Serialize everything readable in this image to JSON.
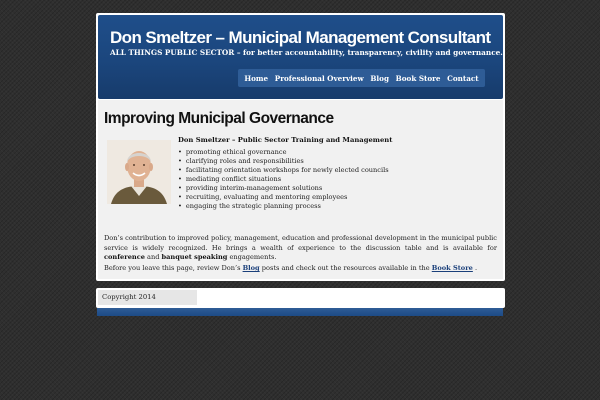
{
  "header": {
    "site_title": "Don Smeltzer – Municipal Management Consultant",
    "tagline": "ALL THINGS PUBLIC SECTOR – for better accountability, transparency, civility and governance."
  },
  "nav": {
    "items": [
      "Home",
      "Professional Overview",
      "Blog",
      "Book Store",
      "Contact"
    ]
  },
  "main": {
    "heading": "Improving Municipal Governance",
    "intro_title": "Don Smeltzer – Public Sector Training and Management",
    "bullets": [
      "promoting ethical governance",
      "clarifying roles and responsibilities",
      "facilitating orientation workshops for newly elected councils",
      "mediating conflict situations",
      "providing interim-management solutions",
      "recruiting, evaluating and mentoring employees",
      "engaging the strategic planning process"
    ],
    "para1": {
      "text": "Don’s contribution to improved policy, management, education and professional development in the municipal public service is widely recognized. He brings a wealth of experience to the discussion table and is available for ",
      "bold1": "conference",
      "and": " and ",
      "bold2": "banquet speaking",
      "end": " engagements."
    },
    "para2": {
      "text1": "Before you leave this page, review Don’s ",
      "link1": "Blog",
      "text2": " posts and check out the resources available in the ",
      "link2": "Book Store",
      "text3": " ."
    }
  },
  "footer": {
    "copyright": "Copyright 2014"
  },
  "colors": {
    "header_blue": "#1f4e8a",
    "nav_blue": "#2e5c96",
    "link": "#1a3f7a"
  }
}
